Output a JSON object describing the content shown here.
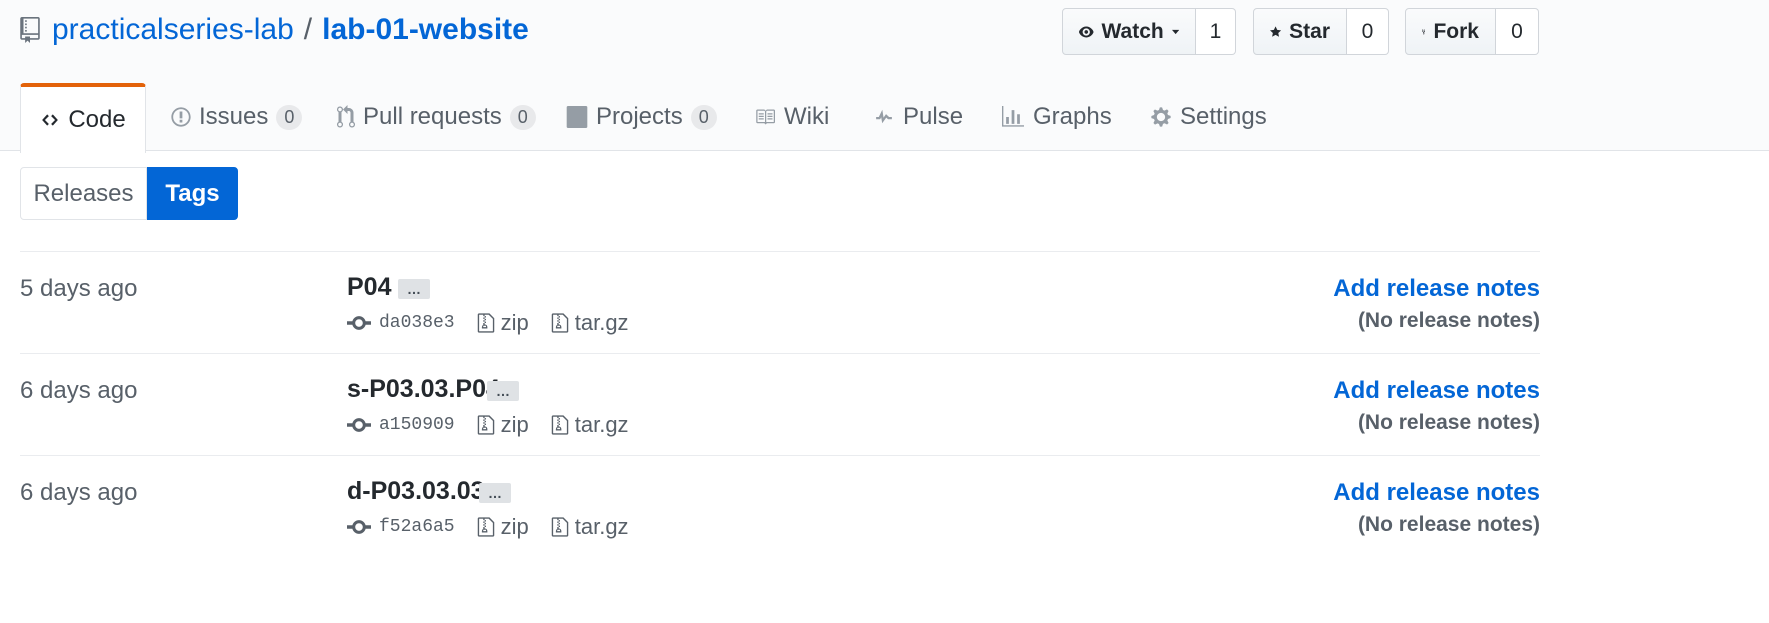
{
  "repo": {
    "owner": "practicalseries-lab",
    "separator": "/",
    "name": "lab-01-website"
  },
  "actions": {
    "watch": {
      "label": "Watch",
      "count": "1"
    },
    "star": {
      "label": "Star",
      "count": "0"
    },
    "fork": {
      "label": "Fork",
      "count": "0"
    }
  },
  "tabs": {
    "code": {
      "label": "Code"
    },
    "issues": {
      "label": "Issues",
      "count": "0"
    },
    "pulls": {
      "label": "Pull requests",
      "count": "0"
    },
    "projects": {
      "label": "Projects",
      "count": "0"
    },
    "wiki": {
      "label": "Wiki"
    },
    "pulse": {
      "label": "Pulse"
    },
    "graphs": {
      "label": "Graphs"
    },
    "settings": {
      "label": "Settings"
    }
  },
  "subnav": {
    "releases": "Releases",
    "tags": "Tags"
  },
  "tags": [
    {
      "date": "5 days ago",
      "name": "P04",
      "sha": "da038e3",
      "zip": "zip",
      "targz": "tar.gz",
      "add_notes": "Add release notes",
      "no_notes": "(No release notes)"
    },
    {
      "date": "6 days ago",
      "name": "s-P03.03.P04",
      "sha": "a150909",
      "zip": "zip",
      "targz": "tar.gz",
      "add_notes": "Add release notes",
      "no_notes": "(No release notes)"
    },
    {
      "date": "6 days ago",
      "name": "d-P03.03.03",
      "sha": "f52a6a5",
      "zip": "zip",
      "targz": "tar.gz",
      "add_notes": "Add release notes",
      "no_notes": "(No release notes)"
    }
  ],
  "ellipsis": "…",
  "colors": {
    "link": "#0366d6",
    "selected_tab_accent": "#e36209",
    "primary_button": "#0366d6"
  }
}
